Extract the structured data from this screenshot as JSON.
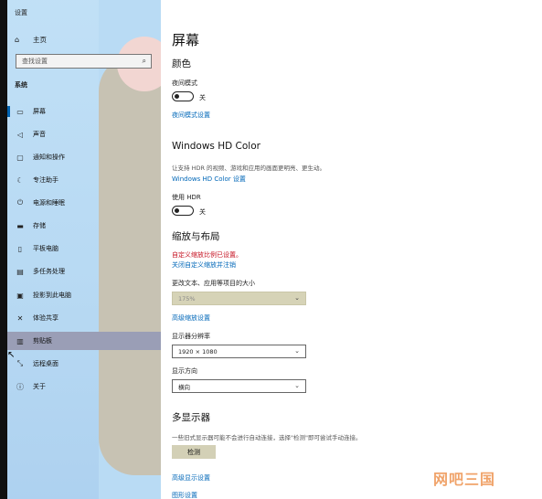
{
  "window": {
    "title": "设置"
  },
  "sidebar": {
    "home": "主页",
    "search_placeholder": "查找设置",
    "section": "系统",
    "items": [
      {
        "label": "屏幕",
        "icon": "monitor-icon"
      },
      {
        "label": "声音",
        "icon": "speaker-icon"
      },
      {
        "label": "通知和操作",
        "icon": "notification-icon"
      },
      {
        "label": "专注助手",
        "icon": "moon-icon"
      },
      {
        "label": "电源和睡眠",
        "icon": "power-icon"
      },
      {
        "label": "存储",
        "icon": "storage-icon"
      },
      {
        "label": "平板电脑",
        "icon": "tablet-icon"
      },
      {
        "label": "多任务处理",
        "icon": "multitask-icon"
      },
      {
        "label": "投影到此电脑",
        "icon": "project-icon"
      },
      {
        "label": "体验共享",
        "icon": "share-icon"
      },
      {
        "label": "剪贴板",
        "icon": "clipboard-icon"
      },
      {
        "label": "远程桌面",
        "icon": "remote-icon"
      },
      {
        "label": "关于",
        "icon": "info-icon"
      }
    ]
  },
  "main": {
    "title": "屏幕",
    "color": {
      "heading": "颜色",
      "night_label": "夜间模式",
      "night_state": "关",
      "night_link": "夜间模式设置"
    },
    "hd": {
      "heading": "Windows HD Color",
      "desc": "让支持 HDR 的视频、游戏和应用的画面更明亮、更生动。",
      "link": "Windows HD Color 设置",
      "hdr_label": "使用 HDR",
      "hdr_state": "关"
    },
    "scale": {
      "heading": "缩放与布局",
      "warn": "自定义缩放比例已设置。",
      "warn_link": "关闭自定义缩放并注销",
      "size_label": "更改文本、应用等项目的大小",
      "size_value": "175%",
      "adv_link": "高级缩放设置",
      "res_label": "显示器分辨率",
      "res_value": "1920 × 1080",
      "orient_label": "显示方向",
      "orient_value": "横向"
    },
    "multi": {
      "heading": "多显示器",
      "desc": "一些旧式显示器可能不会进行自动连接，选择\"检测\"即可尝试手动连接。",
      "detect_btn": "检测",
      "adv_link": "高级显示设置",
      "gfx_link": "图形设置"
    }
  },
  "watermark": "网吧三国"
}
